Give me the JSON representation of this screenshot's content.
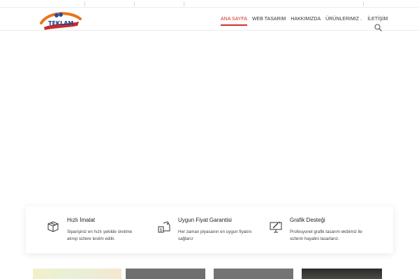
{
  "logo": {
    "text": "TEKLAM",
    "alt": "Logo"
  },
  "nav": {
    "items": [
      {
        "label": "ANA SAYFA"
      },
      {
        "label": "WEB TASARIM"
      },
      {
        "label": "HAKKIMIZDA"
      },
      {
        "label": "ÜRÜNLERIMIZ"
      },
      {
        "label": "İLETİŞİM"
      }
    ],
    "active_index": 0
  },
  "search": {
    "icon": "search-icon"
  },
  "features": [
    {
      "icon": "box-icon",
      "title": "Hızlı İmalat",
      "desc_line1": "Siparişiniz en hızlı şekilde üretime",
      "desc_line2": "alınıp sizlere teslim edilir."
    },
    {
      "icon": "price-tag-icon",
      "title": "Uygun Fiyat Garantisi",
      "desc_line1": "Her zaman piyasanın en uygun fiyatını",
      "desc_line2": "sağlarız"
    },
    {
      "icon": "monitor-design-icon",
      "title": "Grafik Desteği",
      "desc_line1": "Profesyonel grafik tasarım ekibimiz ile",
      "desc_line2": "sizlerin hayalini tasarlarız."
    }
  ],
  "colors": {
    "accent": "#d0312d",
    "text": "#333333"
  }
}
